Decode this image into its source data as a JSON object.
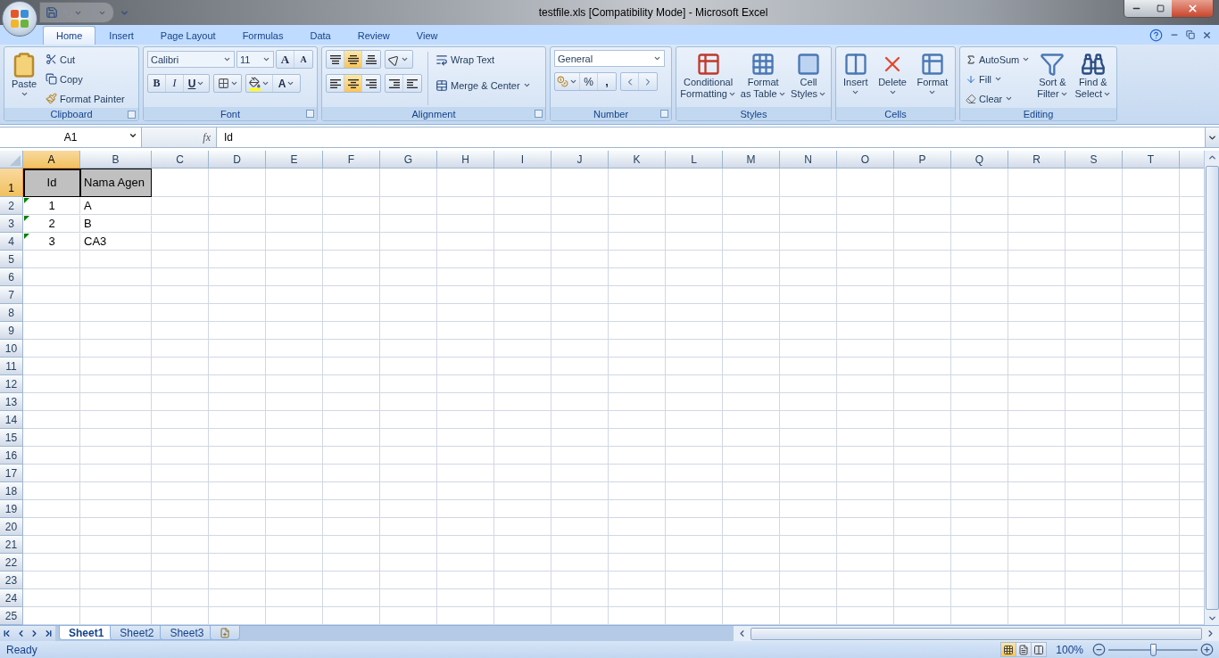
{
  "window": {
    "title": "testfile.xls  [Compatibility Mode] - Microsoft Excel"
  },
  "ribbon_tabs": [
    {
      "label": "Home",
      "selected": true
    },
    {
      "label": "Insert",
      "selected": false
    },
    {
      "label": "Page Layout",
      "selected": false
    },
    {
      "label": "Formulas",
      "selected": false
    },
    {
      "label": "Data",
      "selected": false
    },
    {
      "label": "Review",
      "selected": false
    },
    {
      "label": "View",
      "selected": false
    }
  ],
  "ribbon": {
    "clipboard": {
      "label": "Clipboard",
      "paste": "Paste",
      "cut": "Cut",
      "copy": "Copy",
      "format_painter": "Format Painter"
    },
    "font": {
      "label": "Font",
      "font_name": "Calibri",
      "font_size": "11",
      "grow": "A",
      "shrink": "A",
      "bold": "B",
      "italic": "I",
      "underline": "U",
      "font_color": "A"
    },
    "alignment": {
      "label": "Alignment",
      "wrap_text": "Wrap Text",
      "merge_center": "Merge & Center",
      "vertical": [
        {
          "selected": false
        },
        {
          "selected": true
        },
        {
          "selected": false
        }
      ],
      "horizontal": [
        {
          "selected": false
        },
        {
          "selected": true
        },
        {
          "selected": false
        }
      ]
    },
    "number": {
      "label": "Number",
      "format": "General",
      "percent": "%",
      "comma": ","
    },
    "styles": {
      "label": "Styles",
      "buttons": [
        {
          "lines": [
            "Conditional",
            "Formatting"
          ]
        },
        {
          "lines": [
            "Format",
            "as Table"
          ]
        },
        {
          "lines": [
            "Cell",
            "Styles"
          ]
        }
      ]
    },
    "cells": {
      "label": "Cells",
      "buttons": [
        "Insert",
        "Delete",
        "Format"
      ]
    },
    "editing": {
      "label": "Editing",
      "autosum": "AutoSum",
      "fill": "Fill",
      "clear": "Clear",
      "sort": [
        "Sort &",
        "Filter"
      ],
      "find": [
        "Find &",
        "Select"
      ]
    }
  },
  "formula_bar": {
    "name_box": "A1",
    "fx": "fx",
    "formula": "Id"
  },
  "sheet": {
    "columns": [
      {
        "label": "A",
        "selected": true
      },
      {
        "label": "B",
        "selected": false
      },
      {
        "label": "C",
        "selected": false
      },
      {
        "label": "D",
        "selected": false
      },
      {
        "label": "E",
        "selected": false
      },
      {
        "label": "F",
        "selected": false
      },
      {
        "label": "G",
        "selected": false
      },
      {
        "label": "H",
        "selected": false
      },
      {
        "label": "I",
        "selected": false
      },
      {
        "label": "J",
        "selected": false
      },
      {
        "label": "K",
        "selected": false
      },
      {
        "label": "L",
        "selected": false
      },
      {
        "label": "M",
        "selected": false
      },
      {
        "label": "N",
        "selected": false
      },
      {
        "label": "O",
        "selected": false
      },
      {
        "label": "P",
        "selected": false
      },
      {
        "label": "Q",
        "selected": false
      },
      {
        "label": "R",
        "selected": false
      },
      {
        "label": "S",
        "selected": false
      },
      {
        "label": "T",
        "selected": false
      }
    ],
    "rows": [
      {
        "label": "1",
        "selected": true,
        "cells": [
          {
            "text": "Id",
            "centered": true,
            "shaded": true,
            "active": true,
            "error_marker": false
          },
          {
            "text": "Nama Agen",
            "centered": false,
            "shaded": true,
            "active": false,
            "error_marker": false
          }
        ]
      },
      {
        "label": "2",
        "selected": false,
        "cells": [
          {
            "text": "1",
            "centered": true,
            "shaded": false,
            "active": false,
            "error_marker": true
          },
          {
            "text": "A",
            "centered": false,
            "shaded": false,
            "active": false,
            "error_marker": false
          }
        ]
      },
      {
        "label": "3",
        "selected": false,
        "cells": [
          {
            "text": "2",
            "centered": true,
            "shaded": false,
            "active": false,
            "error_marker": true
          },
          {
            "text": "B",
            "centered": false,
            "shaded": false,
            "active": false,
            "error_marker": false
          }
        ]
      },
      {
        "label": "4",
        "selected": false,
        "cells": [
          {
            "text": "3",
            "centered": true,
            "shaded": false,
            "active": false,
            "error_marker": true
          },
          {
            "text": "CA3",
            "centered": false,
            "shaded": false,
            "active": false,
            "error_marker": false
          }
        ]
      },
      {
        "label": "5",
        "selected": false
      },
      {
        "label": "6",
        "selected": false
      },
      {
        "label": "7",
        "selected": false
      },
      {
        "label": "8",
        "selected": false
      },
      {
        "label": "9",
        "selected": false
      },
      {
        "label": "10",
        "selected": false
      },
      {
        "label": "11",
        "selected": false
      },
      {
        "label": "12",
        "selected": false
      },
      {
        "label": "13",
        "selected": false
      },
      {
        "label": "14",
        "selected": false
      },
      {
        "label": "15",
        "selected": false
      },
      {
        "label": "16",
        "selected": false
      },
      {
        "label": "17",
        "selected": false
      },
      {
        "label": "18",
        "selected": false
      },
      {
        "label": "19",
        "selected": false
      },
      {
        "label": "20",
        "selected": false
      },
      {
        "label": "21",
        "selected": false
      },
      {
        "label": "22",
        "selected": false
      },
      {
        "label": "23",
        "selected": false
      },
      {
        "label": "24",
        "selected": false
      },
      {
        "label": "25",
        "selected": false
      }
    ]
  },
  "sheet_tabs": [
    {
      "label": "Sheet1",
      "selected": true
    },
    {
      "label": "Sheet2",
      "selected": false
    },
    {
      "label": "Sheet3",
      "selected": false
    }
  ],
  "status_bar": {
    "status": "Ready",
    "views": [
      {
        "selected": true
      },
      {
        "selected": false
      },
      {
        "selected": false
      }
    ],
    "zoom": "100%",
    "zoom_slider": {
      "level": 0.5
    }
  }
}
